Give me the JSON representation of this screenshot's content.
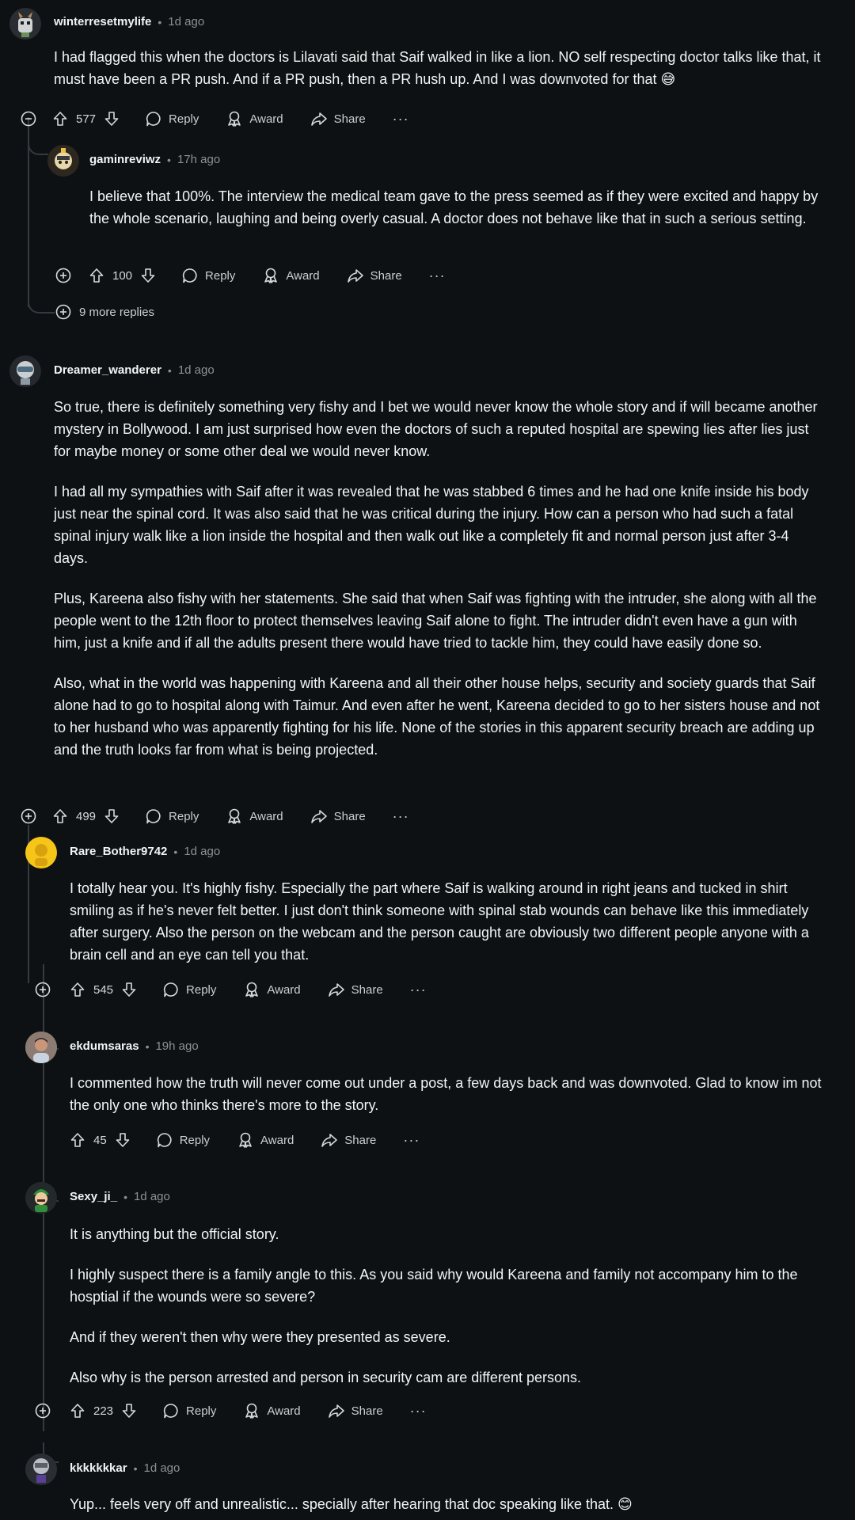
{
  "comments": [
    {
      "author": "winterresetmylife",
      "time": "1d ago",
      "body": [
        "I had flagged this when the doctors is Lilavati said that Saif walked in like a lion. NO self respecting doctor talks like that, it must have been a PR push. And if a PR push, then a PR hush up. And I was downvoted for that 😅"
      ],
      "votes": "577"
    },
    {
      "author": "gaminreviwz",
      "time": "17h ago",
      "body": [
        "I believe that 100%. The interview the medical team gave to the press seemed as if they were excited and happy by the whole scenario, laughing and being overly casual. A doctor does not behave like that in such a serious setting."
      ],
      "votes": "100"
    },
    {
      "author": "Dreamer_wanderer",
      "time": "1d ago",
      "body": [
        "So true, there is definitely something very fishy and I bet we would never know the whole story and if will became another mystery in Bollywood. I am just surprised how even the doctors of such a reputed hospital are spewing lies after lies just for maybe money or some other deal we would never know.",
        "I had all my sympathies with Saif after it was revealed that he was stabbed 6 times and he had one knife inside his body just near the spinal cord. It was also said that he was critical during the injury. How can a person who had such a fatal spinal injury walk like a lion inside the hospital and then walk out like a completely fit and normal person just after 3-4 days.",
        "Plus, Kareena also fishy with her statements. She said that when Saif was fighting with the intruder, she along with all the people went to the 12th floor to protect themselves leaving Saif alone to fight. The intruder didn't even have a gun with him, just a knife and if all the adults present there would have tried to tackle him, they could have easily done so.",
        "Also, what in the world was happening with Kareena and all their other house helps, security and society guards that Saif alone had to go to hospital along with Taimur. And even after he went, Kareena decided to go to her sisters house and not to her husband who was apparently fighting for his life. None of the stories in this apparent security breach are adding up and the truth looks far from what is being projected."
      ],
      "votes": "499"
    },
    {
      "author": "Rare_Bother9742",
      "time": "1d ago",
      "body": [
        "I totally hear you. It's highly fishy. Especially the part where Saif is walking around in right jeans and tucked in shirt smiling as if he's never felt better. I just don't think someone with spinal stab wounds can behave like this immediately after surgery. Also the person on the webcam and the person caught are obviously two different people anyone with a brain cell and an eye can tell you that."
      ],
      "votes": "545"
    },
    {
      "author": "ekdumsaras",
      "time": "19h ago",
      "body": [
        "I commented how the truth will never come out under a post, a few days back and was downvoted. Glad to know im not the only one who thinks there's more to the story."
      ],
      "votes": "45"
    },
    {
      "author": "Sexy_ji_",
      "time": "1d ago",
      "body": [
        "It is anything but the official story.",
        "I highly suspect there is a family angle to this. As you said why would Kareena and family not accompany him to the hosptial if the wounds were so severe?",
        "And if they weren't then why were they presented as severe.",
        "Also why is the person arrested and person in security cam are different persons."
      ],
      "votes": "223"
    },
    {
      "author": "kkkkkkkar",
      "time": "1d ago",
      "body": [
        "Yup... feels very off and unrealistic... specially after hearing that doc speaking like that. 😊"
      ],
      "votes": ""
    }
  ],
  "labels": {
    "dot": "•",
    "reply": "Reply",
    "award": "Award",
    "share": "Share",
    "more": "···"
  },
  "more_replies": "9 more replies",
  "colors": {
    "background": "#0e1113",
    "text": "#f2f4f5",
    "meta": "#8a9195",
    "thread_line": "#343a40"
  }
}
